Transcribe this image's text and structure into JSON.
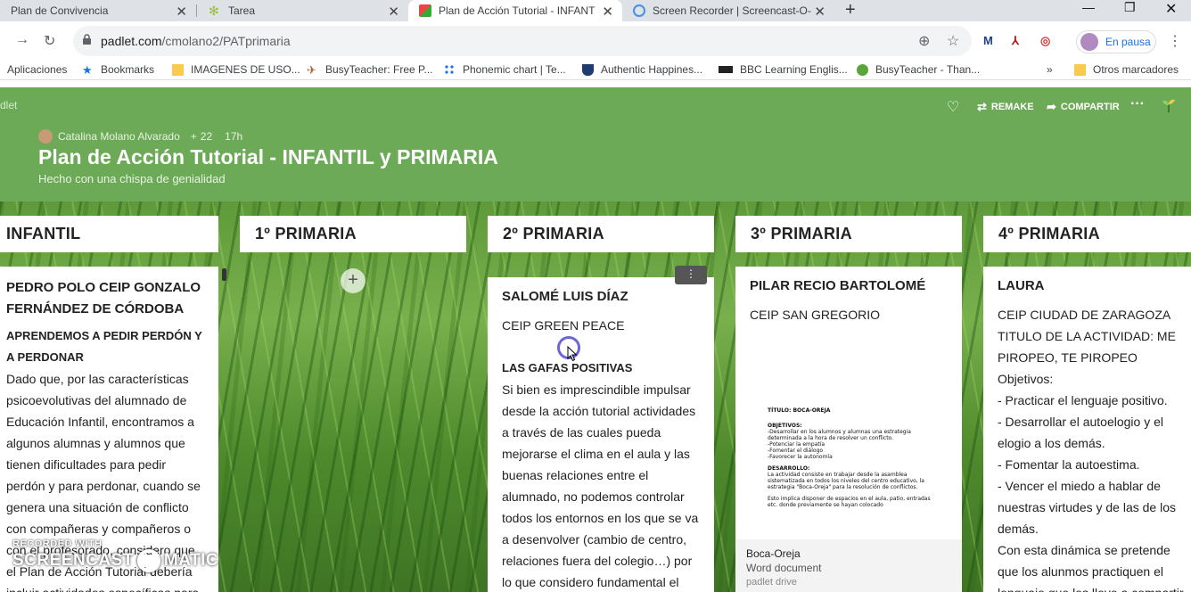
{
  "tabs": [
    {
      "label": "Plan de Convivencia"
    },
    {
      "label": "Tarea"
    },
    {
      "label": "Plan de Acción Tutorial - INFANT"
    },
    {
      "label": "Screen Recorder | Screencast-O-"
    }
  ],
  "address": {
    "host": "padlet.com",
    "path": "/cmolano2/PATprimaria"
  },
  "profile": {
    "status": "En pausa"
  },
  "bookmarks": [
    "Aplicaciones",
    "Bookmarks",
    "IMAGENES DE USO...",
    "BusyTeacher: Free P...",
    "Phonemic chart | Te...",
    "Authentic Happines...",
    "BBC Learning Englis...",
    "BusyTeacher - Than...",
    "»",
    "Otros marcadores"
  ],
  "padlet": {
    "logo": "dlet",
    "author": "Catalina Molano Alvarado",
    "contributors": "22",
    "age": "17h",
    "title": "Plan de Acción Tutorial - INFANTIL y PRIMARIA",
    "subtitle": "Hecho con una chispa de genialidad",
    "remake": "REMAKE",
    "share": "COMPARTIR"
  },
  "columns": [
    "INFANTIL",
    "1º PRIMARIA",
    "2º PRIMARIA",
    "3º PRIMARIA",
    "4º PRIMARIA"
  ],
  "cards": {
    "infantil": {
      "title": "PEDRO POLO CEIP GONZALO FERNÁNDEZ DE CÓRDOBA",
      "subtitle": "APRENDEMOS A PEDIR PERDÓN Y A PERDONAR",
      "body": "Dado que, por las características psicoevolutivas del alumnado de Educación Infantil, encontramos a algunos alumnas y alumnos que tienen dificultades para pedir perdón y para perdonar, cuando se genera una situación de conflicto con compañeras y compañeros o con el profesorado, considero que el Plan de Acción Tutorial debería incluir actividades específicas para"
    },
    "primaria2": {
      "title": "SALOMÉ LUIS DÍAZ",
      "school": "CEIP GREEN PEACE",
      "subtitle": "LAS GAFAS POSITIVAS",
      "body": "Si bien es imprescindible impulsar desde la acción tutorial actividades a través de las cuales pueda mejorarse el clima en el aula y las buenas relaciones entre el alumnado, no podemos controlar todos los entornos en los que se va a desenvolver (cambio de centro, relaciones fuera del colegio…) por lo que considero fundamental el"
    },
    "primaria3": {
      "title": "PILAR RECIO BARTOLOMÉ",
      "school": "CEIP SAN GREGORIO",
      "doc_title": "TÍTULO: BOCA-OREJA",
      "doc_lines": [
        "OBJETIVOS:",
        "-Desarrollar en los alumnos y alumnas una estrategia determinada a la hora de resolver un conflicto.",
        "-Potenciar la empatía",
        "-Fomentar el diálogo",
        "-Favorecer la autonomía",
        "DESARROLLO:",
        "La actividad consiste en trabajar desde la asamblea sistematizada en todos los niveles del centro educativo, la estrategia \"Boca-Oreja\" para la resolución de conflictos.",
        "Esto implica disponer de espacios en el aula, patio, entradas etc. donde previamente se hayan colocado"
      ],
      "attachment_name": "Boca-Oreja",
      "attachment_type": "Word document",
      "attachment_source": "padlet drive"
    },
    "primaria4": {
      "title": "LAURA",
      "lines": [
        "CEIP CIUDAD DE ZARAGOZA",
        "TITULO DE LA ACTIVIDAD: ME PIROPEO, TE PIROPEO",
        "Objetivos:",
        "- Practicar el lenguaje positivo.",
        "- Desarrollar el autoelogio y el elogio a los demás.",
        "- Fomentar la autoestima.",
        "- Vencer el miedo a hablar de nuestras virtudes y de las de los demás.",
        "Con esta dinámica se pretende que los alunmos practiquen el lenguaje que les lleve a compartir"
      ]
    }
  },
  "watermark": {
    "line1": "RECORDED WITH",
    "line2a": "SCREENCAST",
    "line2b": "MATIC"
  },
  "colors": {
    "header": "#6daa58",
    "accent": "#1a73e8"
  },
  "icons": {
    "back": "arrow-right-icon",
    "reload": "reload-icon",
    "lock": "lock-icon",
    "star": "star-icon",
    "heart": "heart-icon",
    "remake": "repeat-icon",
    "share": "share-icon"
  }
}
